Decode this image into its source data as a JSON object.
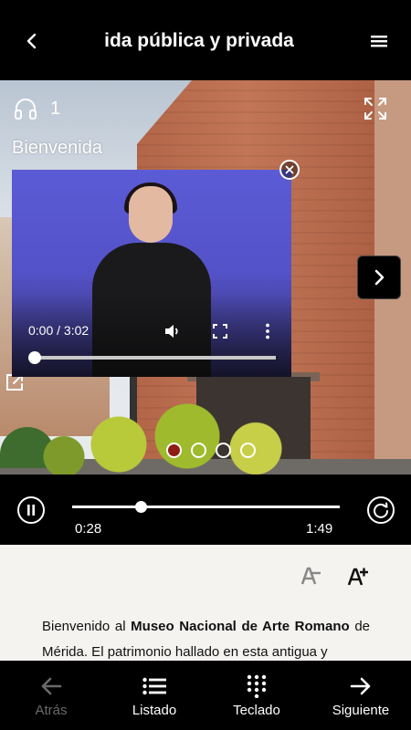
{
  "header": {
    "title": "ida pública y privada"
  },
  "hero": {
    "audio_number": "1",
    "welcome_title": "Bienvenida",
    "carousel_dots": 4,
    "active_dot": 0,
    "accent_color": "#8e1d14"
  },
  "video": {
    "time_display": "0:00 / 3:02",
    "progress_fraction": 0.0
  },
  "player": {
    "elapsed": "0:28",
    "total": "1:49",
    "progress_fraction": 0.257
  },
  "content": {
    "text_before": "Bienvenido al ",
    "text_bold": "Museo Nacional de Arte Romano",
    "text_after": " de Mérida. El patrimonio hallado en esta antigua y"
  },
  "bottom_nav": {
    "back_label": "Atrás",
    "list_label": "Listado",
    "keypad_label": "Teclado",
    "next_label": "Siguiente"
  }
}
